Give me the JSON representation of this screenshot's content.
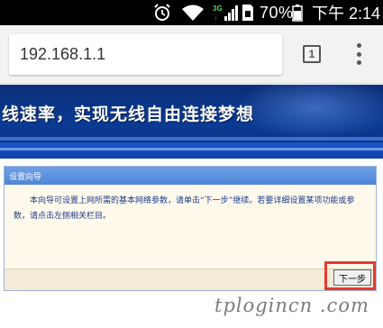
{
  "status_bar": {
    "signal_label": "3G",
    "battery_percent": "70%",
    "time": "下午 2:14"
  },
  "browser": {
    "url": "192.168.1.1",
    "tab_count": "1"
  },
  "banner": {
    "text": "线速率，实现无线自由连接梦想"
  },
  "wizard": {
    "title": "设置向导",
    "message": "本向导可设置上网所需的基本网络参数，请单击“下一步”继续。若要详细设置某项功能或参数，请点击左侧相关栏目。",
    "next_label": "下一步"
  },
  "watermark": "tplogincn .com"
}
